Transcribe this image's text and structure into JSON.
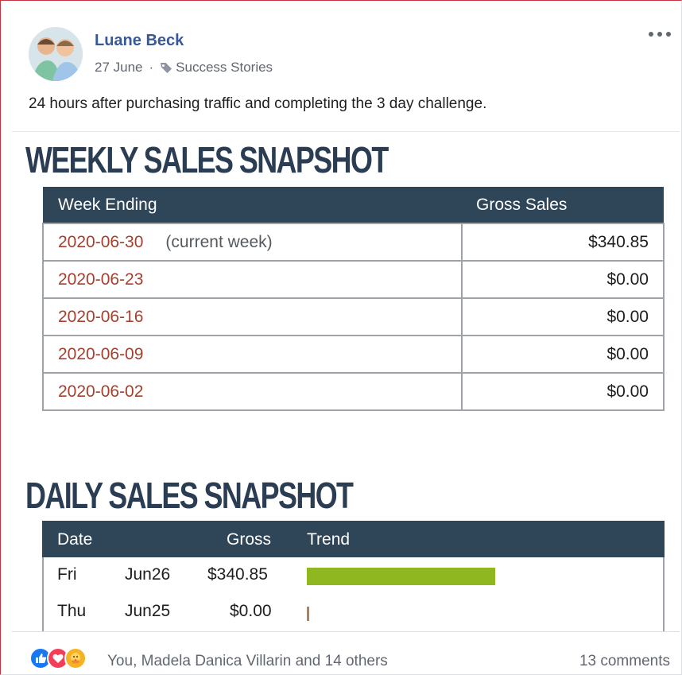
{
  "post": {
    "author": "Luane Beck",
    "date": "27 June",
    "separator": "·",
    "topic": "Success Stories",
    "text": "24 hours after purchasing traffic and completing the 3 day challenge."
  },
  "attachment": {
    "weekly": {
      "heading": "WEEKLY SALES SNAPSHOT",
      "columns": [
        "Week Ending",
        "Gross Sales"
      ],
      "rows": [
        {
          "date": "2020-06-30",
          "note": "(current week)",
          "amount": "$340.85"
        },
        {
          "date": "2020-06-23",
          "note": "",
          "amount": "$0.00"
        },
        {
          "date": "2020-06-16",
          "note": "",
          "amount": "$0.00"
        },
        {
          "date": "2020-06-09",
          "note": "",
          "amount": "$0.00"
        },
        {
          "date": "2020-06-02",
          "note": "",
          "amount": "$0.00"
        }
      ]
    },
    "daily": {
      "heading": "DAILY SALES SNAPSHOT",
      "columns": [
        "Date",
        "Gross",
        "Trend"
      ],
      "rows": [
        {
          "day": "Fri",
          "date": "Jun26",
          "gross": "$340.85",
          "trend": 340.85
        },
        {
          "day": "Thu",
          "date": "Jun25",
          "gross": "$0.00",
          "trend": 0
        }
      ]
    }
  },
  "footer": {
    "reactors": "You, Madela Danica Villarin and 14 others",
    "comments": "13 comments",
    "reactions": [
      "like-icon",
      "love-icon",
      "care-icon"
    ]
  },
  "colors": {
    "author_link": "#385898",
    "table_header": "#2f4558",
    "date_text": "#a5402e",
    "trend_bar": "#8fb820"
  }
}
